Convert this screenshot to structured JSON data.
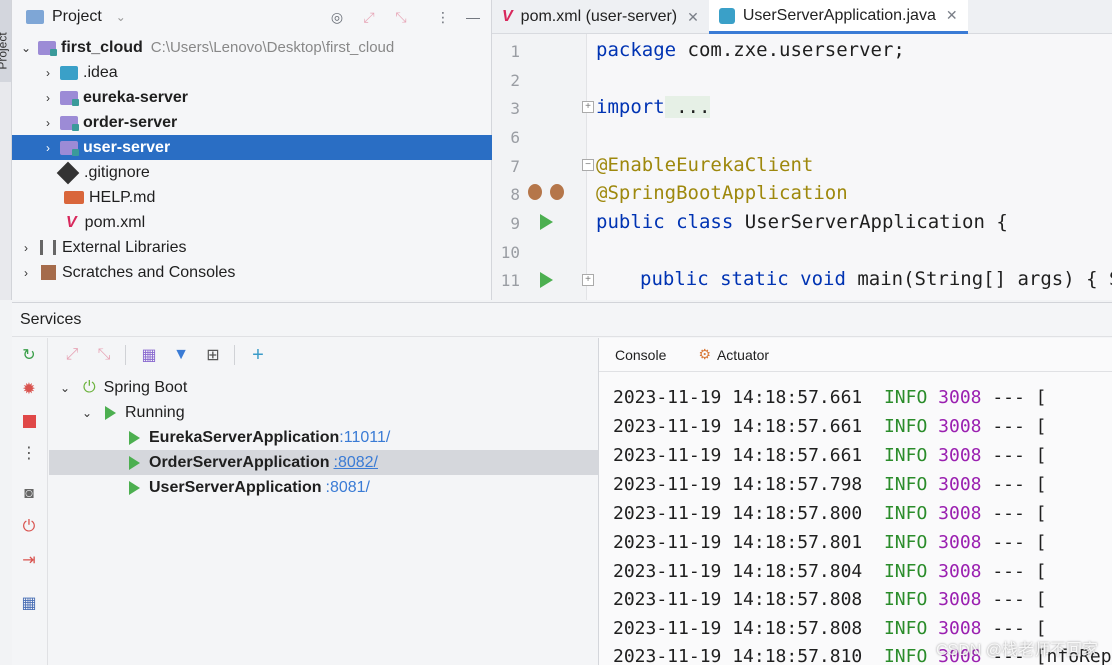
{
  "left_strip": {
    "label": "Project"
  },
  "project": {
    "title": "Project",
    "items": [
      {
        "label": "first_cloud",
        "path": "C:\\Users\\Lenovo\\Desktop\\first_cloud"
      },
      {
        "label": ".idea"
      },
      {
        "label": "eureka-server"
      },
      {
        "label": "order-server"
      },
      {
        "label": "user-server"
      },
      {
        "label": ".gitignore"
      },
      {
        "label": "HELP.md"
      },
      {
        "label": "pom.xml"
      },
      {
        "label": "External Libraries"
      },
      {
        "label": "Scratches and Consoles"
      }
    ]
  },
  "editor": {
    "tabs": [
      {
        "label": "pom.xml (user-server)"
      },
      {
        "label": "UserServerApplication.java"
      }
    ],
    "line_numbers": [
      "1",
      "2",
      "3",
      "6",
      "7",
      "8",
      "9",
      "10",
      "11"
    ],
    "code": {
      "l1_kw": "package",
      "l1_rest": " com.zxe.userserver;",
      "l3_kw": "import",
      "l3_rest": " ...",
      "l7": "@EnableEurekaClient",
      "l8": "@SpringBootApplication",
      "l9_kw": "public class",
      "l9_rest": " UserServerApplication {",
      "l11_kw": "public static void",
      "l11_rest": " main(String[] args) { Sp"
    }
  },
  "services": {
    "title": "Services",
    "tree": {
      "root": "Spring Boot",
      "group": "Running",
      "apps": [
        {
          "name": "EurekaServerApplication",
          "port": ":11011/"
        },
        {
          "name": "OrderServerApplication",
          "port": ":8082/"
        },
        {
          "name": "UserServerApplication",
          "port": ":8081/"
        }
      ]
    }
  },
  "console": {
    "tabs": [
      "Console",
      "Actuator"
    ],
    "logs": [
      {
        "ts": "2023-11-19 14:18:57.661",
        "level": "INFO",
        "pid": "3008",
        "rest": " --- ["
      },
      {
        "ts": "2023-11-19 14:18:57.661",
        "level": "INFO",
        "pid": "3008",
        "rest": " --- ["
      },
      {
        "ts": "2023-11-19 14:18:57.661",
        "level": "INFO",
        "pid": "3008",
        "rest": " --- ["
      },
      {
        "ts": "2023-11-19 14:18:57.798",
        "level": "INFO",
        "pid": "3008",
        "rest": " --- ["
      },
      {
        "ts": "2023-11-19 14:18:57.800",
        "level": "INFO",
        "pid": "3008",
        "rest": " --- ["
      },
      {
        "ts": "2023-11-19 14:18:57.801",
        "level": "INFO",
        "pid": "3008",
        "rest": " --- ["
      },
      {
        "ts": "2023-11-19 14:18:57.804",
        "level": "INFO",
        "pid": "3008",
        "rest": " --- ["
      },
      {
        "ts": "2023-11-19 14:18:57.808",
        "level": "INFO",
        "pid": "3008",
        "rest": " --- ["
      },
      {
        "ts": "2023-11-19 14:18:57.808",
        "level": "INFO",
        "pid": "3008",
        "rest": " --- ["
      },
      {
        "ts": "2023-11-19 14:18:57.810",
        "level": "INFO",
        "pid": "3008",
        "rest": " --- [nfoRep"
      }
    ],
    "watermark": "CSDN @栈老师不回家"
  },
  "colors": {
    "accent": "#2a6ec4",
    "run_green": "#4caf50",
    "info_green": "#2a8c2a",
    "pid_purple": "#9a1fb0",
    "port_blue": "#3a7bd5"
  },
  "icons": [
    "target-icon",
    "expand-icon",
    "collapse-icon",
    "more-icon",
    "maven-icon",
    "java-class-icon",
    "refresh-icon",
    "debug-icon",
    "stop-icon",
    "camera-icon",
    "plug-icon",
    "exit-icon",
    "layout-icon",
    "group-icon",
    "filter-icon",
    "new-tab-icon",
    "add-icon",
    "run-icon",
    "spring-icon",
    "actuator-icon"
  ]
}
